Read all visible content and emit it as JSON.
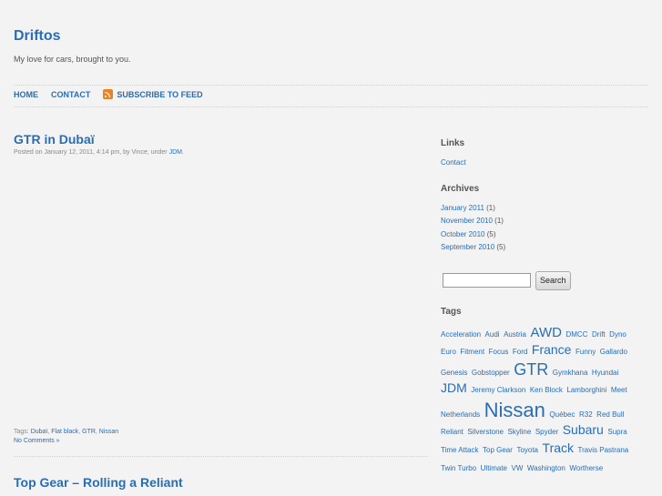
{
  "site": {
    "title": "Driftos",
    "tagline": "My love for cars, brought to you."
  },
  "nav": {
    "home": "HOME",
    "contact": "CONTACT",
    "feed": "SUBSCRIBE TO FEED"
  },
  "posts": [
    {
      "title": "GTR in Dubaï",
      "meta_prefix": "Posted on January 12, 2011, 4:14 pm, by Vince, under",
      "category": "JDM",
      "meta_suffix": ".",
      "tags_label": "Tags:",
      "tags": [
        "Dubaï",
        "Flat black",
        "GTR",
        "Nissan"
      ],
      "comments": "No Comments »"
    },
    {
      "title": "Top Gear – Rolling a Reliant"
    }
  ],
  "sidebar": {
    "links_title": "Links",
    "links": [
      "Contact"
    ],
    "archives_title": "Archives",
    "archives": [
      {
        "label": "January 2011",
        "count": "(1)"
      },
      {
        "label": "November 2010",
        "count": "(1)"
      },
      {
        "label": "October 2010",
        "count": "(5)"
      },
      {
        "label": "September 2010",
        "count": "(5)"
      }
    ],
    "search_button": "Search",
    "search_value": "",
    "tags_title": "Tags",
    "tag_cloud": [
      {
        "name": "Acceleration",
        "size": 8
      },
      {
        "name": "Audi",
        "size": 8
      },
      {
        "name": "Austria",
        "size": 8
      },
      {
        "name": "AWD",
        "size": 15
      },
      {
        "name": "DMCC",
        "size": 8
      },
      {
        "name": "Drift",
        "size": 8
      },
      {
        "name": "Dyno",
        "size": 8
      },
      {
        "name": "Euro",
        "size": 8
      },
      {
        "name": "Fitment",
        "size": 8
      },
      {
        "name": "Focus",
        "size": 8
      },
      {
        "name": "Ford",
        "size": 8
      },
      {
        "name": "France",
        "size": 14
      },
      {
        "name": "Funny",
        "size": 8
      },
      {
        "name": "Gallardo",
        "size": 8
      },
      {
        "name": "Genesis",
        "size": 8
      },
      {
        "name": "Gobstopper",
        "size": 8
      },
      {
        "name": "GTR",
        "size": 18
      },
      {
        "name": "Gymkhana",
        "size": 8
      },
      {
        "name": "Hyundai",
        "size": 8
      },
      {
        "name": "JDM",
        "size": 14
      },
      {
        "name": "Jeremy Clarkson",
        "size": 8
      },
      {
        "name": "Ken Block",
        "size": 8
      },
      {
        "name": "Lamborghini",
        "size": 8
      },
      {
        "name": "Meet",
        "size": 8
      },
      {
        "name": "Netherlands",
        "size": 8
      },
      {
        "name": "Nissan",
        "size": 22
      },
      {
        "name": "Québec",
        "size": 8
      },
      {
        "name": "R32",
        "size": 8
      },
      {
        "name": "Red Bull",
        "size": 8
      },
      {
        "name": "Reliant",
        "size": 8
      },
      {
        "name": "Silverstone",
        "size": 8
      },
      {
        "name": "Skyline",
        "size": 8
      },
      {
        "name": "Spyder",
        "size": 8
      },
      {
        "name": "Subaru",
        "size": 14
      },
      {
        "name": "Supra",
        "size": 8
      },
      {
        "name": "Time Attack",
        "size": 8
      },
      {
        "name": "Top Gear",
        "size": 8
      },
      {
        "name": "Toyota",
        "size": 8
      },
      {
        "name": "Track",
        "size": 14
      },
      {
        "name": "Travis Pastrana",
        "size": 8
      },
      {
        "name": "Twin Turbo",
        "size": 8
      },
      {
        "name": "Ultimate",
        "size": 8
      },
      {
        "name": "VW",
        "size": 8
      },
      {
        "name": "Washington",
        "size": 8
      },
      {
        "name": "Wortherse",
        "size": 8
      }
    ]
  },
  "colors": {
    "link": "#2a6db3",
    "background": "#f3f3f3",
    "rss": "#e98426"
  }
}
